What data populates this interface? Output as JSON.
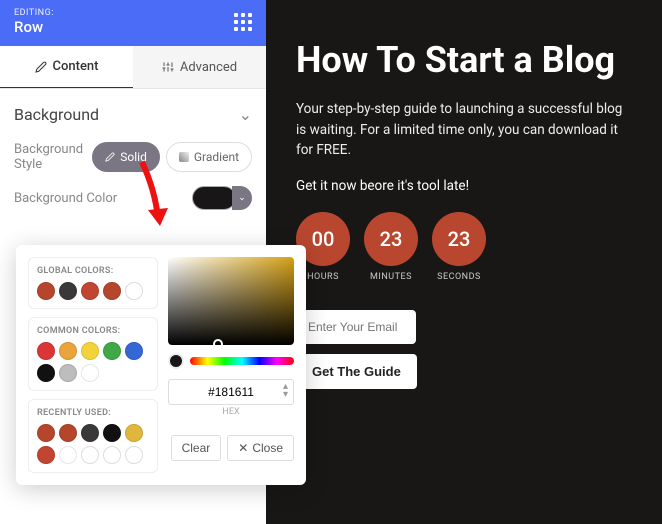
{
  "header": {
    "editing": "EDITING:",
    "element": "Row"
  },
  "tabs": {
    "content": "Content",
    "advanced": "Advanced"
  },
  "background": {
    "title": "Background",
    "style_label": "Background Style",
    "solid": "Solid",
    "gradient": "Gradient",
    "color_label": "Background Color"
  },
  "picker": {
    "global_label": "GLOBAL COLORS:",
    "common_label": "COMMON COLORS:",
    "recent_label": "RECENTLY USED:",
    "hex_value": "#181611",
    "hex_label": "HEX",
    "clear": "Clear",
    "close": "Close",
    "global_colors": [
      "#b6462b",
      "#3a3838",
      "#c14531",
      "#b6462b"
    ],
    "common_colors": [
      "#d93636",
      "#e9a43b",
      "#f3d33c",
      "#3fa847",
      "#3366d6",
      "#111111",
      "#bdbdbd",
      "#ffffff"
    ],
    "recent_colors": [
      "#b6462b",
      "#b6462b",
      "#3a3838",
      "#111111",
      "#e0b63c",
      "#c14531",
      "#ffffff"
    ]
  },
  "preview": {
    "title": "How To Start a Blog",
    "subtitle": "Your step-by-step guide to launching a successful blog is waiting. For a limited time only, you can download it for FREE.",
    "cta_line": "Get it now beore it's tool late!",
    "countdown": [
      {
        "value": "00",
        "label": "HOURS"
      },
      {
        "value": "23",
        "label": "MINUTES"
      },
      {
        "value": "23",
        "label": "SECONDS"
      }
    ],
    "email_placeholder": "Enter Your Email",
    "button": "Get The Guide"
  }
}
